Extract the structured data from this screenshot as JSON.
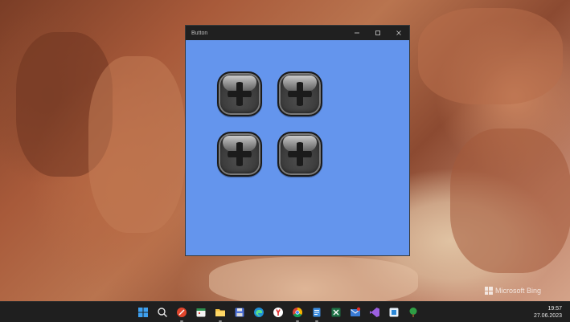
{
  "window": {
    "title": "Button",
    "client_color": "#6495ed",
    "buttons": [
      {
        "name": "plus-button-1",
        "icon": "plus-icon"
      },
      {
        "name": "plus-button-2",
        "icon": "plus-icon"
      },
      {
        "name": "plus-button-3",
        "icon": "plus-icon"
      },
      {
        "name": "plus-button-4",
        "icon": "plus-icon"
      }
    ],
    "controls": [
      "minimize-icon",
      "maximize-icon",
      "close-icon"
    ]
  },
  "desktop": {
    "watermark": "Microsoft Bing"
  },
  "taskbar": {
    "icons": [
      "windows-start-icon",
      "search-icon",
      "app-icon",
      "calendar-app-icon",
      "file-explorer-icon",
      "save-app-icon",
      "edge-browser-icon",
      "yandex-browser-icon",
      "chrome-icon",
      "notes-app-icon",
      "excel-app-icon",
      "mail-app-icon",
      "visual-studio-icon",
      "store-app-icon",
      "tree-app-icon"
    ],
    "clock": {
      "time": "19:57",
      "date": "27.06.2023"
    }
  }
}
